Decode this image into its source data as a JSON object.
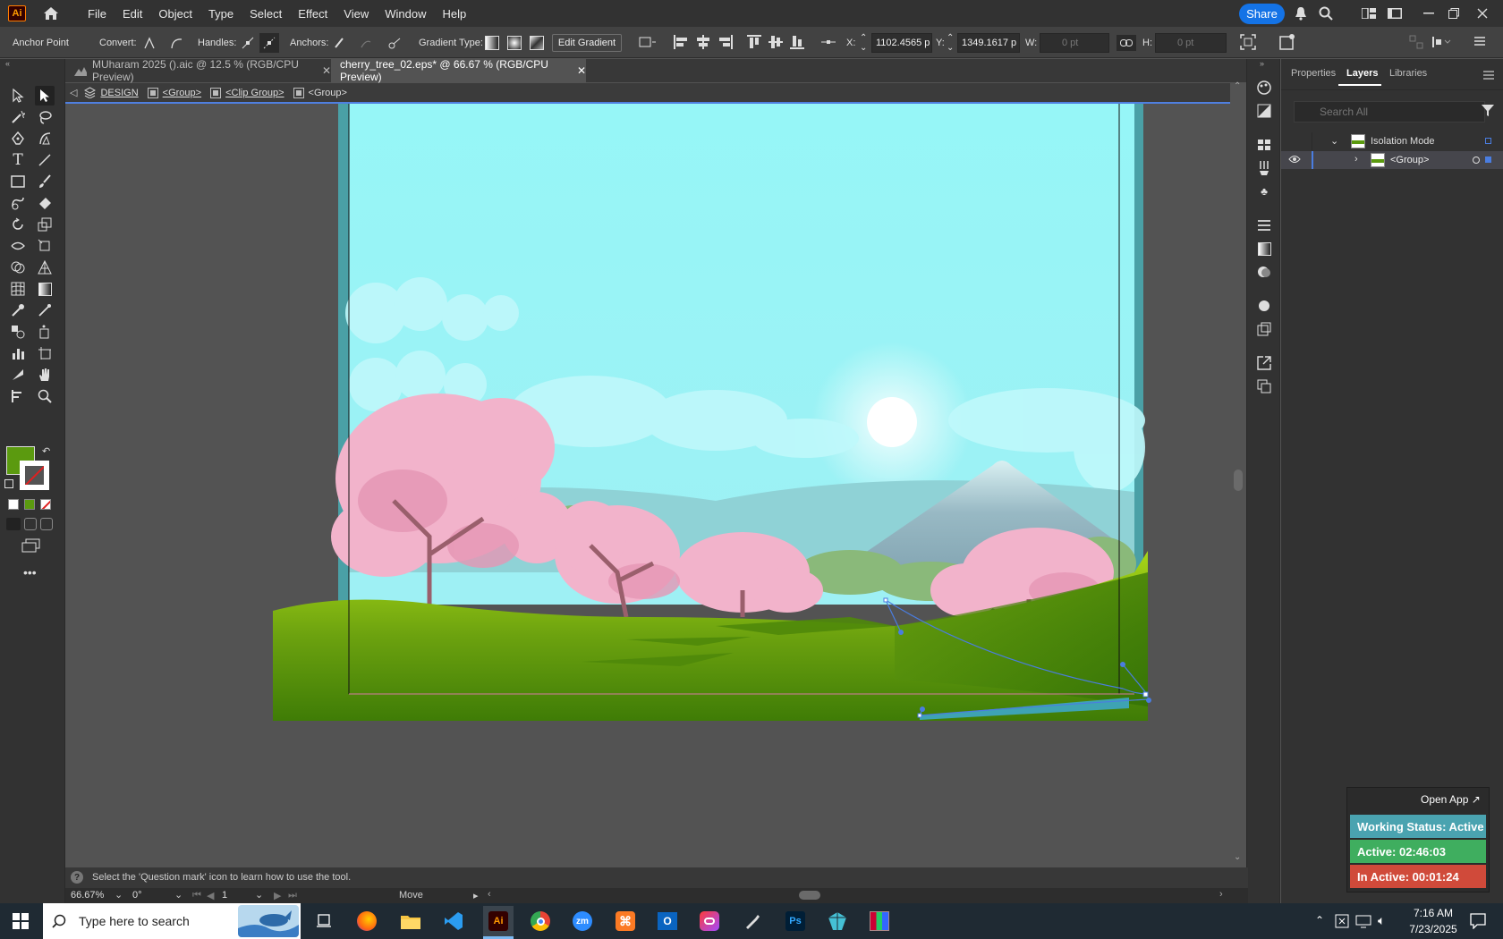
{
  "app": {
    "logo": "Ai"
  },
  "menu": [
    "File",
    "Edit",
    "Object",
    "Type",
    "Select",
    "Effect",
    "View",
    "Window",
    "Help"
  ],
  "share_label": "Share",
  "control": {
    "tool_name": "Anchor Point",
    "convert_label": "Convert:",
    "handles_label": "Handles:",
    "anchors_label": "Anchors:",
    "gradient_type_label": "Gradient Type:",
    "edit_gradient": "Edit Gradient",
    "x_label": "X:",
    "x_value": "1102.4565 p",
    "y_label": "Y:",
    "y_value": "1349.1617 p",
    "w_label": "W:",
    "w_value": "0 pt",
    "h_label": "H:",
    "h_value": "0 pt"
  },
  "tabs": [
    {
      "label": "MUharam 2025 ().aic @ 12.5 % (RGB/CPU Preview)"
    },
    {
      "label": "cherry_tree_02.eps* @ 66.67 % (RGB/CPU Preview)"
    }
  ],
  "breadcrumb": [
    "DESIGN",
    "<Group>",
    "<Clip Group>",
    "<Group>"
  ],
  "panel": {
    "tabs": [
      "Properties",
      "Layers",
      "Libraries"
    ],
    "search_placeholder": "Search All",
    "rows": [
      {
        "label": "Isolation Mode"
      },
      {
        "label": "<Group>"
      }
    ]
  },
  "status": {
    "hint": "Select the 'Question mark' icon to learn how to use the tool.",
    "zoom": "66.67%",
    "rotation": "0°",
    "artboard": "1",
    "mode": "Move"
  },
  "timer": {
    "open_app": "Open App ↗",
    "working": "Working Status: Active",
    "active": "Active: 02:46:03",
    "inactive": "In Active: 00:01:24",
    "colors": {
      "working": "#4aa3b0",
      "active": "#3fae5f",
      "inactive": "#d04a3a"
    }
  },
  "taskbar": {
    "search_placeholder": "Type here to search",
    "time": "7:16 AM",
    "date": "7/23/2025"
  }
}
